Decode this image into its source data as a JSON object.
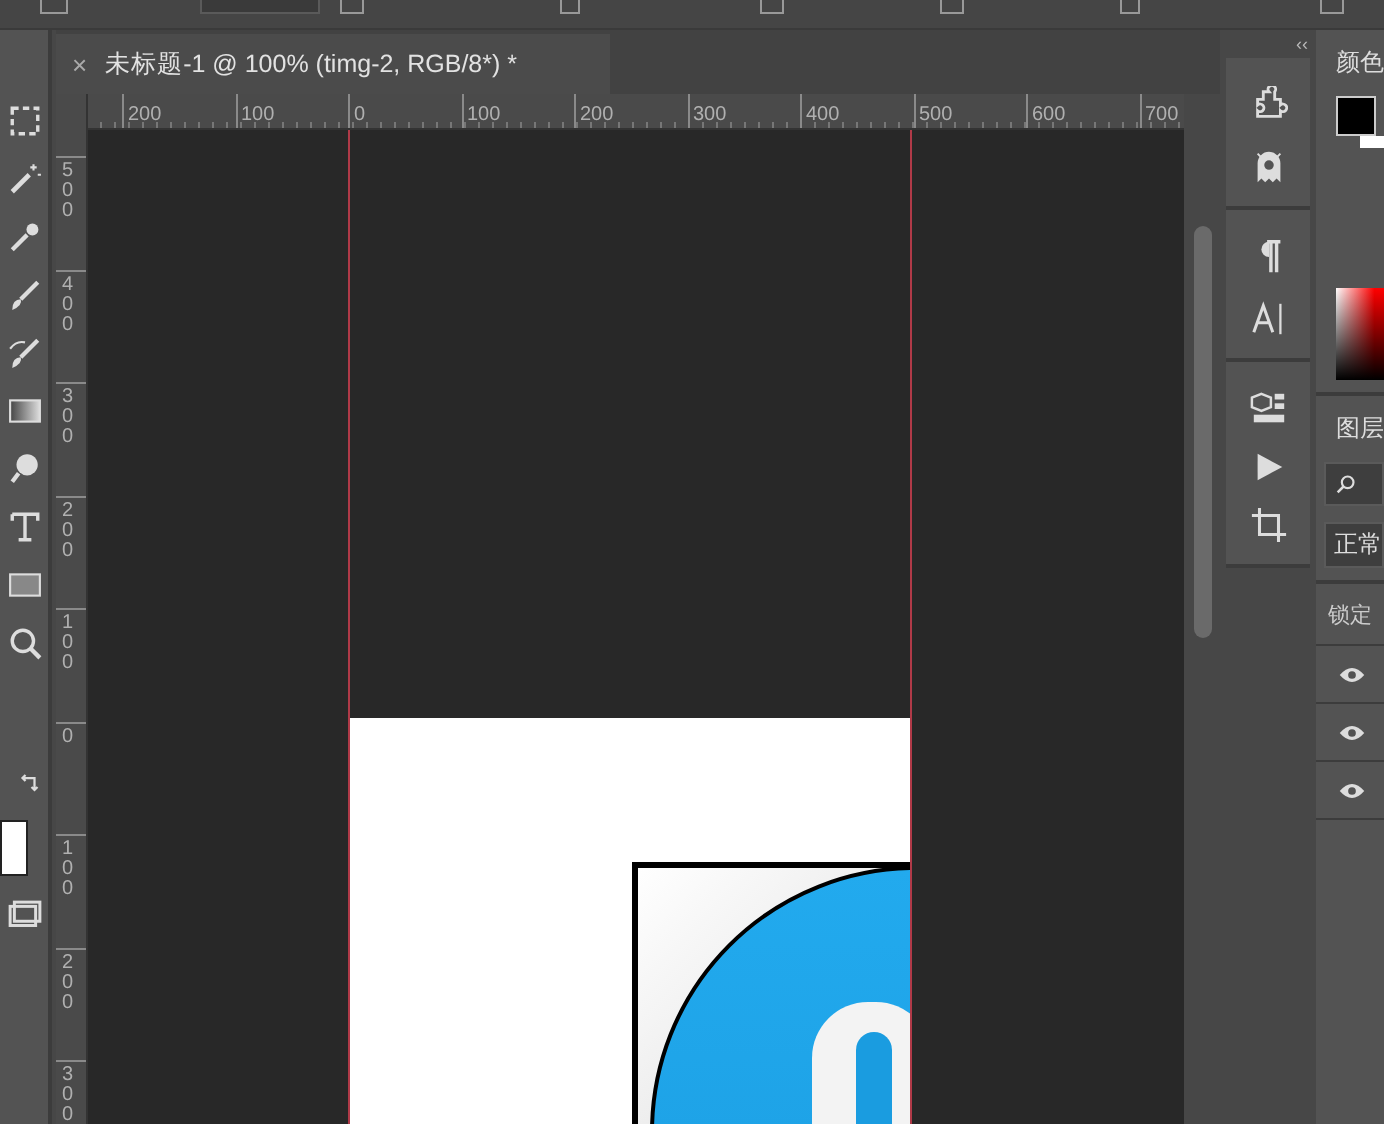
{
  "document_tab": {
    "close": "×",
    "title": "未标题-1 @ 100% (timg-2, RGB/8*) *"
  },
  "ruler_horizontal": [
    "200",
    "100",
    "0",
    "100",
    "200",
    "300",
    "400",
    "500",
    "600",
    "700"
  ],
  "ruler_vertical": [
    "500",
    "400",
    "300",
    "200",
    "100",
    "0",
    "100",
    "200",
    "300"
  ],
  "panel_collapse": "‹‹",
  "color_panel": {
    "title": "颜色"
  },
  "layers_panel": {
    "title": "图层",
    "blend_mode": "正常",
    "lock_label": "锁定",
    "layers": [
      {
        "visible": true
      },
      {
        "visible": true
      },
      {
        "visible": true
      }
    ]
  }
}
